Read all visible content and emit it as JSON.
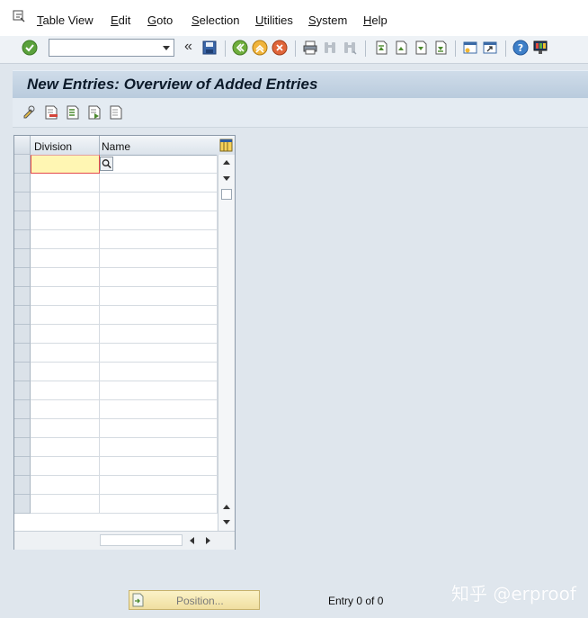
{
  "menu": {
    "items": [
      {
        "label": "Table View",
        "mnemonic": "T",
        "rest": "able View"
      },
      {
        "label": "Edit",
        "mnemonic": "E",
        "rest": "dit"
      },
      {
        "label": "Goto",
        "mnemonic": "G",
        "rest": "oto"
      },
      {
        "label": "Selection",
        "mnemonic": "S",
        "rest": "election"
      },
      {
        "label": "Utilities",
        "mnemonic": "U",
        "rest": "tilities"
      },
      {
        "label": "System",
        "mnemonic": "S",
        "rest": "ystem"
      },
      {
        "label": "Help",
        "mnemonic": "H",
        "rest": "elp"
      }
    ]
  },
  "toolbar": {
    "command_value": "",
    "expand_glyph": "«"
  },
  "title": "New Entries: Overview of Added Entries",
  "table": {
    "columns": [
      "Division",
      "Name"
    ],
    "row_count": 19
  },
  "footer": {
    "position_label": "Position...",
    "entry_text": "Entry 0 of 0"
  },
  "watermark": "知乎 @erproof",
  "colors": {
    "accent": "#0c1a2a",
    "button_bg": "#f0dfa0",
    "active_cell": "#fff6b3"
  }
}
